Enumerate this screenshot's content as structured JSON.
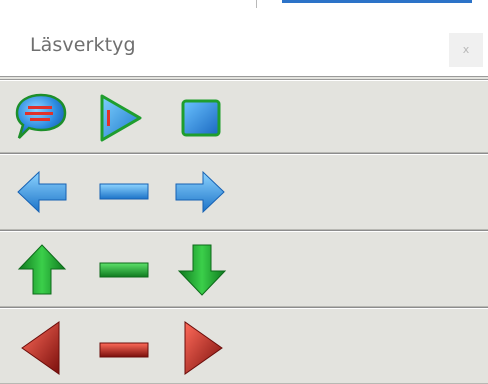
{
  "window": {
    "title": "Läsverktyg",
    "close_label": "x"
  },
  "toolbars": [
    {
      "name": "playback",
      "buttons": [
        {
          "icon": "speech-bubble-icon",
          "color": "#3a8fd8"
        },
        {
          "icon": "play-icon",
          "color": "#2e9be0"
        },
        {
          "icon": "stop-icon",
          "color": "#2a86db"
        }
      ]
    },
    {
      "name": "horizontal-nav",
      "buttons": [
        {
          "icon": "arrow-left-icon",
          "color": "#2f8fe0"
        },
        {
          "icon": "dash-icon",
          "color": "#2f8fe0"
        },
        {
          "icon": "arrow-right-icon",
          "color": "#2f8fe0"
        }
      ]
    },
    {
      "name": "vertical-nav",
      "buttons": [
        {
          "icon": "arrow-up-icon",
          "color": "#1f9e2e"
        },
        {
          "icon": "dash-icon",
          "color": "#1f9e2e"
        },
        {
          "icon": "arrow-down-icon",
          "color": "#1f9e2e"
        }
      ]
    },
    {
      "name": "red-nav",
      "buttons": [
        {
          "icon": "arrow-left-icon",
          "color": "#b8201e"
        },
        {
          "icon": "dash-icon",
          "color": "#b8201e"
        },
        {
          "icon": "arrow-right-icon",
          "color": "#b8201e"
        }
      ]
    }
  ]
}
